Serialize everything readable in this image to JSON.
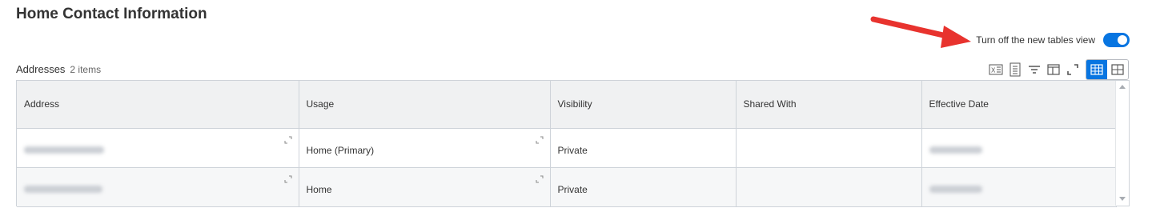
{
  "page": {
    "title": "Home Contact Information"
  },
  "toggle": {
    "label": "Turn off the new tables view",
    "state": "on"
  },
  "section": {
    "title": "Addresses",
    "count": "2 items"
  },
  "toolbar": {
    "icons": [
      "excel-export-icon",
      "print-icon",
      "filter-icon",
      "column-layout-icon",
      "fullscreen-icon",
      "table-view-icon",
      "grid-view-icon"
    ],
    "active_view": "table-view"
  },
  "table": {
    "columns": [
      "Address",
      "Usage",
      "Visibility",
      "Shared With",
      "Effective Date"
    ],
    "rows": [
      {
        "usage": "Home (Primary)",
        "visibility": "Private",
        "shared_with": ""
      },
      {
        "usage": "Home",
        "visibility": "Private",
        "shared_with": ""
      }
    ]
  },
  "colors": {
    "accent": "#0875e1",
    "annotation": "#e8332e",
    "header_bg": "#f0f1f2",
    "border": "#ced3d9"
  }
}
